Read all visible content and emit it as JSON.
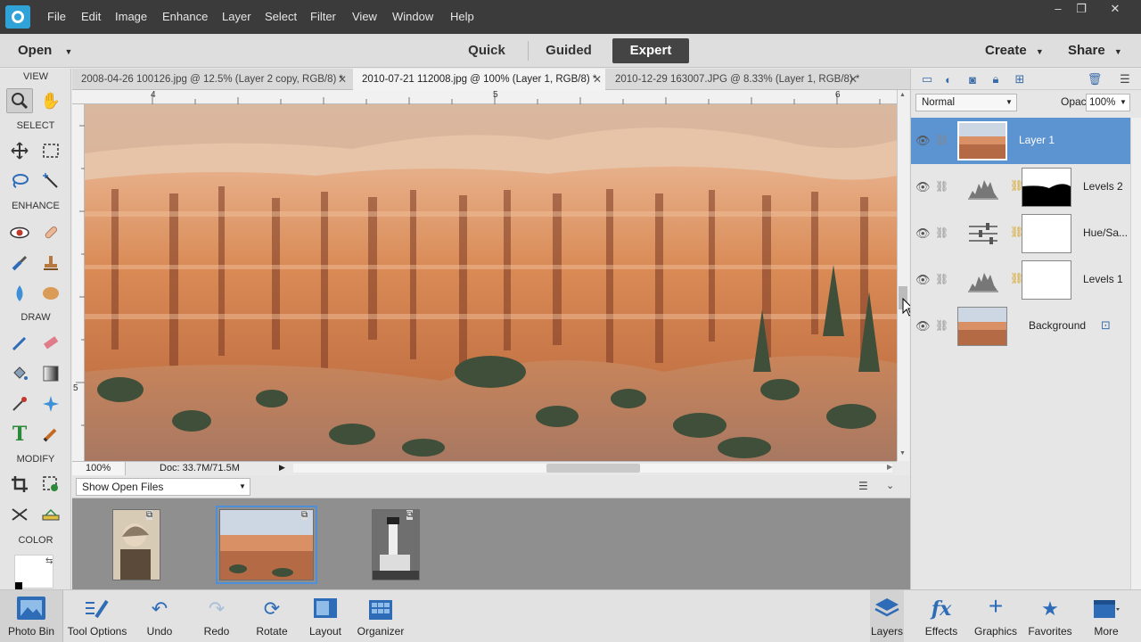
{
  "menubar": {
    "items": [
      "File",
      "Edit",
      "Image",
      "Enhance",
      "Layer",
      "Select",
      "Filter",
      "View",
      "Window",
      "Help"
    ],
    "window_controls": [
      "–",
      "❐",
      "✕"
    ]
  },
  "modebar": {
    "open_label": "Open",
    "tabs": [
      "Quick",
      "Guided",
      "Expert"
    ],
    "active_tab": "Expert",
    "create_label": "Create",
    "share_label": "Share"
  },
  "toolbox": {
    "sections": [
      "VIEW",
      "SELECT",
      "ENHANCE",
      "DRAW",
      "MODIFY",
      "COLOR"
    ]
  },
  "doc_tabs": [
    {
      "label": "2008-04-26 100126.jpg @ 12.5% (Layer 2 copy, RGB/8) *",
      "active": false
    },
    {
      "label": "2010-07-21 112008.jpg @ 100% (Layer 1, RGB/8) *",
      "active": true
    },
    {
      "label": "2010-12-29 163007.JPG @ 8.33% (Layer 1, RGB/8) *",
      "active": false
    }
  ],
  "rulers": {
    "top_ticks": [
      "4",
      "5",
      "6"
    ],
    "left_ticks": [
      "5"
    ]
  },
  "status": {
    "zoom": "100%",
    "doc_info": "Doc: 33.7M/71.5M"
  },
  "photo_bin": {
    "filter_label": "Show Open Files"
  },
  "layers_panel": {
    "blend_mode": "Normal",
    "opacity_label": "Opacity:",
    "opacity_value": "100%",
    "layers": [
      {
        "name": "Layer 1",
        "selected": true
      },
      {
        "name": "Levels 2",
        "selected": false
      },
      {
        "name": "Hue/Sa...",
        "selected": false
      },
      {
        "name": "Levels 1",
        "selected": false
      },
      {
        "name": "Background",
        "selected": false
      }
    ]
  },
  "taskbar": {
    "left": [
      "Photo Bin",
      "Tool Options",
      "Undo",
      "Redo",
      "Rotate",
      "Layout",
      "Organizer"
    ],
    "right": [
      "Layers",
      "Effects",
      "Graphics",
      "Favorites",
      "More"
    ]
  },
  "colors": {
    "accent": "#5c93d1",
    "menubar_bg": "#3b3b3b",
    "icon_blue": "#2e6cb8"
  }
}
